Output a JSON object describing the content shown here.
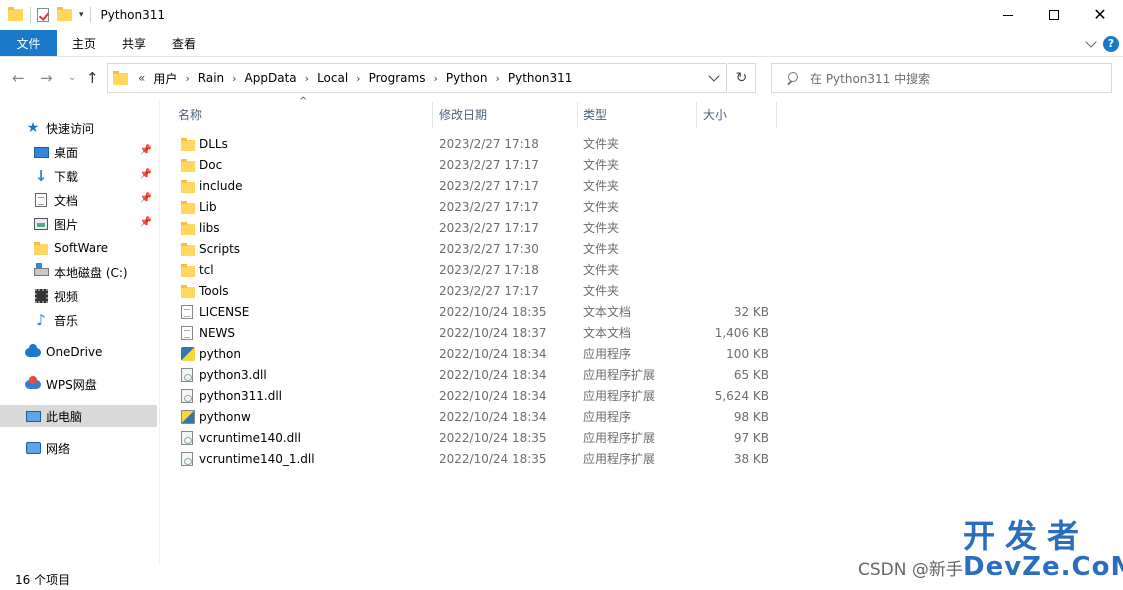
{
  "window": {
    "title": "Python311",
    "controls": {
      "minimize": "—",
      "maximize": "☐",
      "close": "✕"
    }
  },
  "ribbon": {
    "tabs": [
      "文件",
      "主页",
      "共享",
      "查看"
    ],
    "help": "?"
  },
  "address": {
    "prefix": "«",
    "crumbs": [
      "用户",
      "Rain",
      "AppData",
      "Local",
      "Programs",
      "Python",
      "Python311"
    ]
  },
  "search": {
    "placeholder": "在 Python311 中搜索"
  },
  "sidebar": {
    "items": [
      {
        "label": "快速访问",
        "icon": "star-icon",
        "pinned": false
      },
      {
        "label": "桌面",
        "icon": "desktop-icon",
        "pinned": true
      },
      {
        "label": "下载",
        "icon": "download-icon",
        "pinned": true
      },
      {
        "label": "文档",
        "icon": "document-icon",
        "pinned": true
      },
      {
        "label": "图片",
        "icon": "pictures-icon",
        "pinned": true
      },
      {
        "label": "SoftWare",
        "icon": "folder-icon",
        "pinned": false
      },
      {
        "label": "本地磁盘 (C:)",
        "icon": "drive-icon",
        "pinned": false
      },
      {
        "label": "视频",
        "icon": "video-icon",
        "pinned": false
      },
      {
        "label": "音乐",
        "icon": "music-icon",
        "pinned": false
      },
      {
        "label": "OneDrive",
        "icon": "cloud-icon",
        "pinned": false
      },
      {
        "label": "WPS网盘",
        "icon": "wps-cloud-icon",
        "pinned": false
      },
      {
        "label": "此电脑",
        "icon": "computer-icon",
        "pinned": false,
        "selected": true
      },
      {
        "label": "网络",
        "icon": "network-icon",
        "pinned": false
      }
    ]
  },
  "columns": {
    "name": "名称",
    "date": "修改日期",
    "type": "类型",
    "size": "大小"
  },
  "files": [
    {
      "name": "DLLs",
      "date": "2023/2/27 17:18",
      "type": "文件夹",
      "size": "",
      "icon": "folder-icon"
    },
    {
      "name": "Doc",
      "date": "2023/2/27 17:17",
      "type": "文件夹",
      "size": "",
      "icon": "folder-icon"
    },
    {
      "name": "include",
      "date": "2023/2/27 17:17",
      "type": "文件夹",
      "size": "",
      "icon": "folder-icon"
    },
    {
      "name": "Lib",
      "date": "2023/2/27 17:17",
      "type": "文件夹",
      "size": "",
      "icon": "folder-icon"
    },
    {
      "name": "libs",
      "date": "2023/2/27 17:17",
      "type": "文件夹",
      "size": "",
      "icon": "folder-icon"
    },
    {
      "name": "Scripts",
      "date": "2023/2/27 17:30",
      "type": "文件夹",
      "size": "",
      "icon": "folder-icon"
    },
    {
      "name": "tcl",
      "date": "2023/2/27 17:18",
      "type": "文件夹",
      "size": "",
      "icon": "folder-icon"
    },
    {
      "name": "Tools",
      "date": "2023/2/27 17:17",
      "type": "文件夹",
      "size": "",
      "icon": "folder-icon"
    },
    {
      "name": "LICENSE",
      "date": "2022/10/24 18:35",
      "type": "文本文档",
      "size": "32 KB",
      "icon": "text-file-icon"
    },
    {
      "name": "NEWS",
      "date": "2022/10/24 18:37",
      "type": "文本文档",
      "size": "1,406 KB",
      "icon": "text-file-icon"
    },
    {
      "name": "python",
      "date": "2022/10/24 18:34",
      "type": "应用程序",
      "size": "100 KB",
      "icon": "python-exe-icon"
    },
    {
      "name": "python3.dll",
      "date": "2022/10/24 18:34",
      "type": "应用程序扩展",
      "size": "65 KB",
      "icon": "dll-icon"
    },
    {
      "name": "python311.dll",
      "date": "2022/10/24 18:34",
      "type": "应用程序扩展",
      "size": "5,624 KB",
      "icon": "dll-icon"
    },
    {
      "name": "pythonw",
      "date": "2022/10/24 18:34",
      "type": "应用程序",
      "size": "98 KB",
      "icon": "pythonw-exe-icon"
    },
    {
      "name": "vcruntime140.dll",
      "date": "2022/10/24 18:35",
      "type": "应用程序扩展",
      "size": "97 KB",
      "icon": "dll-icon"
    },
    {
      "name": "vcruntime140_1.dll",
      "date": "2022/10/24 18:35",
      "type": "应用程序扩展",
      "size": "38 KB",
      "icon": "dll-icon"
    }
  ],
  "status": {
    "count": "16 个项目"
  },
  "watermark": {
    "csdn": "CSDN @新手",
    "brand_cn": "开发者",
    "brand_en": "DevZe.CoM"
  }
}
